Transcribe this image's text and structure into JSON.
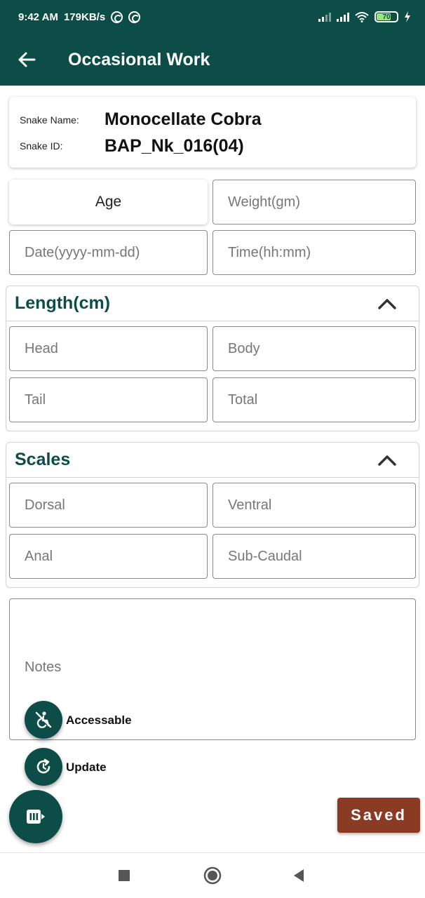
{
  "status_bar": {
    "time": "9:42 AM",
    "net_speed": "179KB/s",
    "battery": "70"
  },
  "app_bar": {
    "title": "Occasional Work",
    "back_icon": "arrow-left-icon"
  },
  "snake": {
    "name_label": "Snake Name:",
    "name": "Monocellate Cobra",
    "id_label": "Snake ID:",
    "id": "BAP_Nk_016(04)"
  },
  "basic": {
    "age_label": "Age",
    "weight_placeholder": "Weight(gm)",
    "date_placeholder": "Date(yyyy-mm-dd)",
    "time_placeholder": "Time(hh:mm)"
  },
  "length": {
    "title": "Length(cm)",
    "head_placeholder": "Head",
    "body_placeholder": "Body",
    "tail_placeholder": "Tail",
    "total_placeholder": "Total"
  },
  "scales": {
    "title": "Scales",
    "dorsal_placeholder": "Dorsal",
    "ventral_placeholder": "Ventral",
    "anal_placeholder": "Anal",
    "subcaudal_placeholder": "Sub-Caudal"
  },
  "notes": {
    "placeholder": "Notes"
  },
  "fab_menu": {
    "accessable_label": "Accessable",
    "update_label": "Update"
  },
  "saved_label": "Saved",
  "colors": {
    "primary": "#0d4d47",
    "saved_button": "#8b3a24"
  }
}
